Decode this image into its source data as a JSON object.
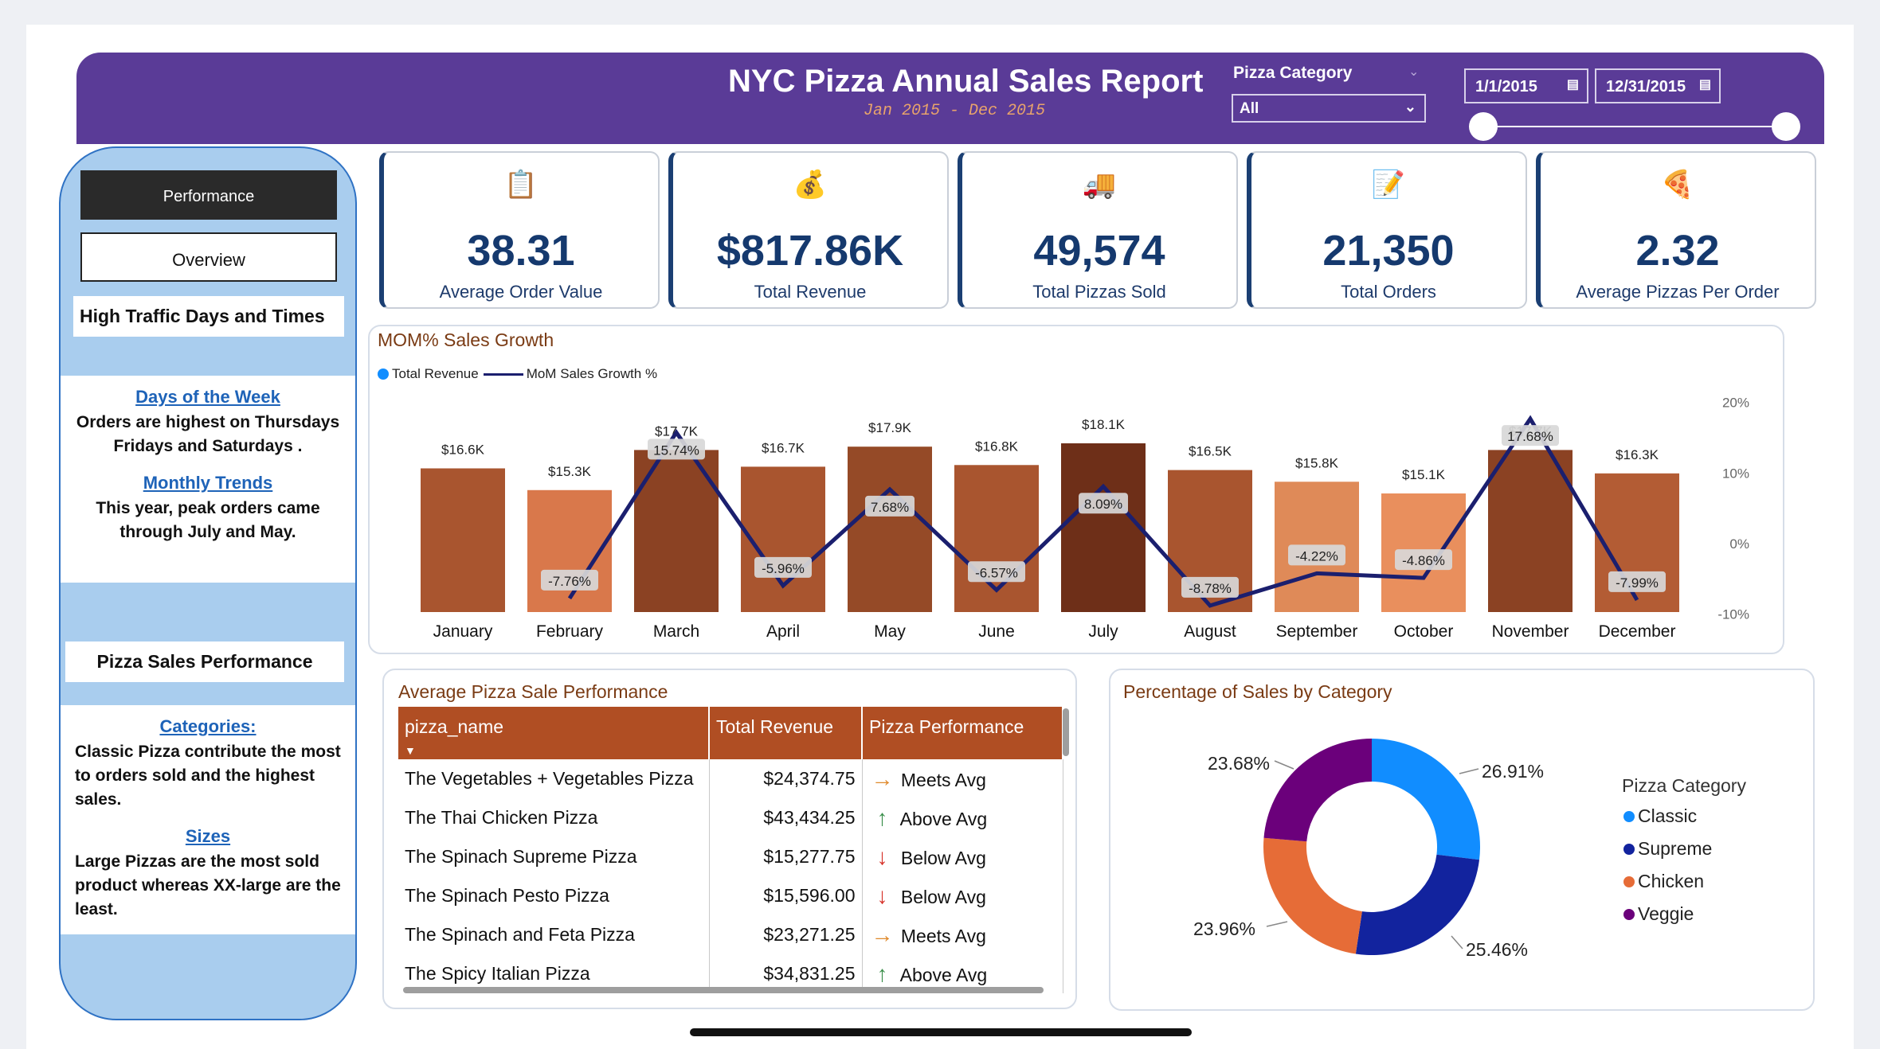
{
  "header": {
    "title": "NYC Pizza Annual Sales Report",
    "subtitle": "Jan 2015 - Dec 2015",
    "category_label": "Pizza Category",
    "category_value": "All",
    "start_date": "1/1/2015",
    "end_date": "12/31/2015"
  },
  "sidebar": {
    "performance_label": "Performance",
    "overview_label": "Overview",
    "traffic_heading": "High Traffic Days and Times",
    "days_link": "Days of the Week",
    "days_text": "Orders are highest on Thursdays Fridays and Saturdays .",
    "monthly_link": "Monthly Trends",
    "monthly_text": "This year, peak orders came through July and May.",
    "sales_heading": "Pizza Sales Performance",
    "categories_link": "Categories:",
    "categories_text": "Classic Pizza contribute the most to orders sold and the highest sales.",
    "sizes_link": "Sizes",
    "sizes_text": "Large Pizzas are the most sold product whereas XX-large are the least."
  },
  "kpis": [
    {
      "value": "38.31",
      "label": "Average Order Value",
      "icon": "clipboard-icon"
    },
    {
      "value": "$817.86K",
      "label": "Total Revenue",
      "icon": "money-icon"
    },
    {
      "value": "49,574",
      "label": "Total Pizzas Sold",
      "icon": "delivery-icon"
    },
    {
      "value": "21,350",
      "label": "Total Orders",
      "icon": "order-list-icon"
    },
    {
      "value": "2.32",
      "label": "Average Pizzas Per Order",
      "icon": "pizza-icon"
    }
  ],
  "mom_chart": {
    "title": "MOM% Sales Growth",
    "legend_revenue": "Total Revenue",
    "legend_growth": "MoM Sales Growth %",
    "y2_ticks": [
      "20%",
      "10%",
      "0%",
      "-10%"
    ]
  },
  "chart_data": {
    "type": "bar",
    "categories": [
      "January",
      "February",
      "March",
      "April",
      "May",
      "June",
      "July",
      "August",
      "September",
      "October",
      "November",
      "December"
    ],
    "series": [
      {
        "name": "Total Revenue",
        "type": "bar",
        "values": [
          16.6,
          15.3,
          17.7,
          16.7,
          17.9,
          16.8,
          18.1,
          16.5,
          15.8,
          15.1,
          17.7,
          16.3
        ],
        "labels": [
          "$16.6K",
          "$15.3K",
          "$17.7K",
          "$16.7K",
          "$17.9K",
          "$16.8K",
          "$18.1K",
          "$16.5K",
          "$15.8K",
          "$15.1K",
          "$17.7K",
          "$16.3K"
        ]
      },
      {
        "name": "MoM Sales Growth %",
        "type": "line",
        "values": [
          null,
          -7.76,
          15.74,
          -5.96,
          7.68,
          -6.57,
          8.09,
          -8.78,
          -4.22,
          -4.86,
          17.68,
          -7.99
        ],
        "labels": [
          "",
          "-7.76%",
          "15.74%",
          "-5.96%",
          "7.68%",
          "-6.57%",
          "8.09%",
          "-8.78%",
          "-4.22%",
          "-4.86%",
          "17.68%",
          "-7.99%"
        ]
      }
    ],
    "bar_colors": [
      "#a9552f",
      "#d9784b",
      "#8b4223",
      "#a9552f",
      "#954a27",
      "#a9552f",
      "#6e2f18",
      "#a9552f",
      "#df8a58",
      "#e98f5d",
      "#8b4223",
      "#b35c34"
    ],
    "title": "MOM% Sales Growth",
    "y2lim": [
      -10,
      20
    ]
  },
  "table": {
    "title": "Average Pizza Sale Performance",
    "headers": [
      "pizza_name",
      "Total Revenue",
      "Pizza Performance"
    ],
    "rows": [
      {
        "name": "The Vegetables + Vegetables Pizza",
        "revenue": "$24,374.75",
        "perf": "Meets Avg",
        "icon": "right-arrow-icon",
        "color": "#e08a2c"
      },
      {
        "name": "The Thai Chicken Pizza",
        "revenue": "$43,434.25",
        "perf": "Above Avg",
        "icon": "up-arrow-icon",
        "color": "#3a8f4a"
      },
      {
        "name": "The Spinach Supreme Pizza",
        "revenue": "$15,277.75",
        "perf": "Below Avg",
        "icon": "down-arrow-icon",
        "color": "#d6332a"
      },
      {
        "name": "The Spinach Pesto Pizza",
        "revenue": "$15,596.00",
        "perf": "Below Avg",
        "icon": "down-arrow-icon",
        "color": "#d6332a"
      },
      {
        "name": "The Spinach and Feta Pizza",
        "revenue": "$23,271.25",
        "perf": "Meets Avg",
        "icon": "right-arrow-icon",
        "color": "#e08a2c"
      },
      {
        "name": "The Spicy Italian Pizza",
        "revenue": "$34,831.25",
        "perf": "Above Avg",
        "icon": "up-arrow-icon",
        "color": "#3a8f4a"
      }
    ]
  },
  "pie": {
    "title": "Percentage of Sales by Category",
    "legend_title": "Pizza Category",
    "slices": [
      {
        "name": "Classic",
        "value": 26.91,
        "label": "26.91%",
        "color": "#118dff"
      },
      {
        "name": "Supreme",
        "value": 25.46,
        "label": "25.46%",
        "color": "#12239e"
      },
      {
        "name": "Chicken",
        "value": 23.96,
        "label": "23.96%",
        "color": "#e66c37"
      },
      {
        "name": "Veggie",
        "value": 23.68,
        "label": "23.68%",
        "color": "#6b007b"
      }
    ]
  }
}
